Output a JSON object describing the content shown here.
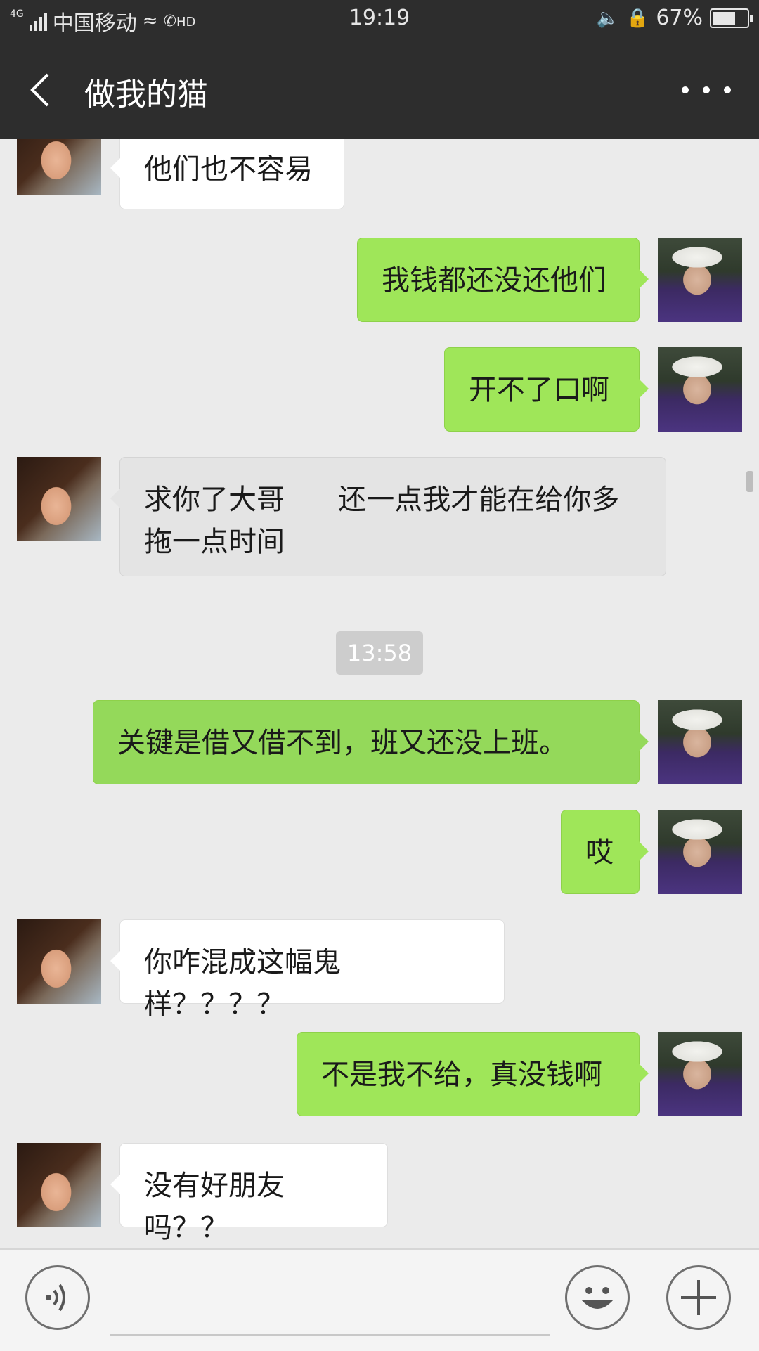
{
  "status_bar": {
    "network": "4G",
    "carrier": "中国移动",
    "hd": "HD",
    "time": "19:19",
    "battery": "67%"
  },
  "header": {
    "back_icon": "chevron-left-icon",
    "title": "做我的猫",
    "more_icon": "more-horizontal-icon"
  },
  "messages": [
    {
      "side": "in",
      "text": "他们也不容易"
    },
    {
      "side": "out",
      "text": "我钱都还没还他们"
    },
    {
      "side": "out",
      "text": "开不了口啊"
    },
    {
      "side": "in",
      "text": "求你了大哥      还一点我才能在给你多拖一点时间"
    },
    {
      "side": "out",
      "text": "关键是借又借不到，班又还没上班。"
    },
    {
      "side": "out",
      "text": "哎"
    },
    {
      "side": "in",
      "text": "你咋混成这幅鬼样？？？？"
    },
    {
      "side": "out",
      "text": "不是我不给，真没钱啊"
    },
    {
      "side": "in",
      "text": "没有好朋友吗？？"
    }
  ],
  "timestamp": "13:58",
  "input_bar": {
    "voice_icon": "voice-icon",
    "emoji_icon": "emoji-icon",
    "plus_icon": "plus-icon",
    "input_value": ""
  },
  "colors": {
    "bar": "#2d2d2d",
    "out_bubble": "#9fe659",
    "in_bubble": "#ffffff",
    "background": "#ebebeb"
  }
}
